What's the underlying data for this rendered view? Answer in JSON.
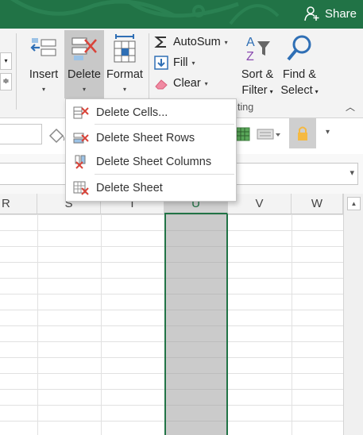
{
  "title_bar": {
    "share_label": "Share",
    "accent": "#217346"
  },
  "ribbon": {
    "insert": {
      "label": "Insert",
      "icon": "insert-cells-icon"
    },
    "delete": {
      "label": "Delete",
      "icon": "delete-cells-icon"
    },
    "format": {
      "label": "Format",
      "icon": "format-cells-icon"
    },
    "autosum": {
      "label": "AutoSum",
      "icon": "sigma-icon"
    },
    "fill": {
      "label": "Fill",
      "icon": "fill-down-icon"
    },
    "clear": {
      "label": "Clear",
      "icon": "eraser-icon"
    },
    "sort_filter": {
      "label1": "Sort &",
      "label2": "Filter",
      "icon": "sort-filter-icon"
    },
    "find_select": {
      "label1": "Find &",
      "label2": "Select",
      "icon": "magnifier-icon"
    },
    "group_label_partial": "ting"
  },
  "delete_menu": {
    "items": [
      {
        "label": "Delete Cells...",
        "icon": "delete-cells-icon"
      },
      {
        "label": "Delete Sheet Rows",
        "icon": "delete-rows-icon"
      },
      {
        "label": "Delete Sheet Columns",
        "icon": "delete-columns-icon"
      },
      {
        "label": "Delete Sheet",
        "icon": "delete-sheet-icon"
      }
    ]
  },
  "grid": {
    "columns": [
      "R",
      "S",
      "T",
      "U",
      "V",
      "W"
    ],
    "selected_column": "U",
    "selection_color": "#217346"
  }
}
